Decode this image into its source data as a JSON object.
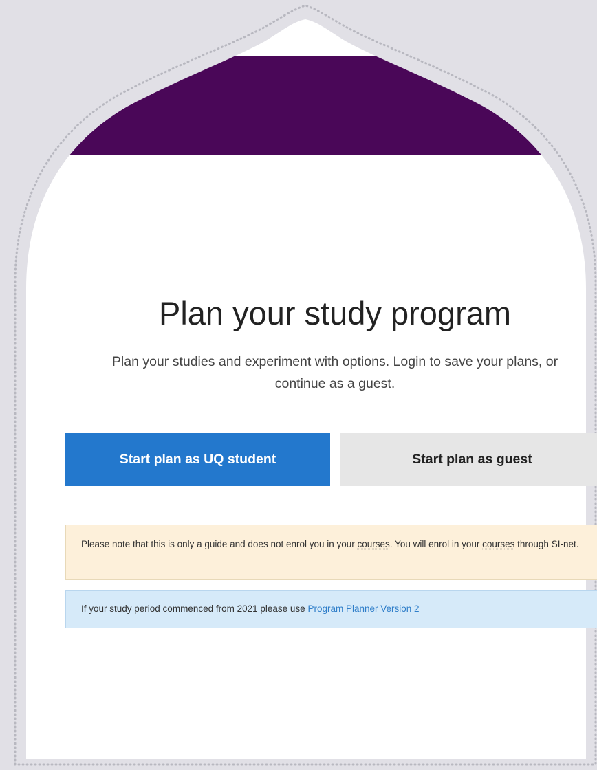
{
  "colors": {
    "backdrop": "#e1e0e6",
    "header_purple": "#4a0758",
    "primary_button": "#2378cd",
    "secondary_button": "#e6e6e6",
    "warning_bg": "#fdf0da",
    "info_bg": "#d6eaf9",
    "link": "#2f7ec9"
  },
  "main": {
    "title": "Plan your study program",
    "subtitle_line1": "Plan your studies and experiment with options. Login to save your plans, or",
    "subtitle_line2": "continue as a guest."
  },
  "actions": {
    "student_label": "Start plan as UQ student",
    "guest_label": "Start plan as guest"
  },
  "notice": {
    "part1": "Please note that this is only a guide and does not enrol you in your ",
    "courses_1": "courses",
    "part2": ". You will enrol in your ",
    "courses_2": "courses",
    "part3": " through SI-net."
  },
  "info": {
    "text": "If your study period commenced from 2021 please use ",
    "link_label": "Program Planner Version 2"
  }
}
